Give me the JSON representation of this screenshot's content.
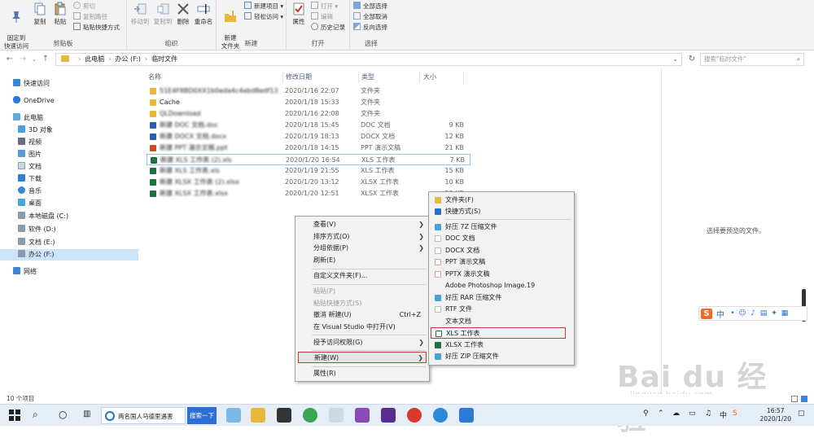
{
  "ribbon": {
    "clipboard": {
      "pin_label": "固定到\n快速访问",
      "copy_label": "复制",
      "paste_label": "粘贴",
      "cut_label": "剪切",
      "copy_path_label": "复制路径",
      "paste_shortcut_label": "粘贴快捷方式",
      "group_label": "剪贴板"
    },
    "organize": {
      "move_to_label": "移动到",
      "copy_to_label": "复制到",
      "delete_label": "删除",
      "rename_label": "重命名",
      "group_label": "组织"
    },
    "new": {
      "new_folder_label": "新建\n文件夹",
      "new_item_label": "新建项目 ▾",
      "easy_access_label": "轻松访问 ▾",
      "group_label": "新建"
    },
    "open": {
      "properties_label": "属性",
      "open_label": "打开 ▾",
      "edit_label": "编辑",
      "history_label": "历史记录",
      "group_label": "打开"
    },
    "select": {
      "select_all_label": "全部选择",
      "select_none_label": "全部取消",
      "invert_label": "反向选择",
      "group_label": "选择"
    }
  },
  "address": {
    "crumbs": [
      "此电脑",
      "办公 (F:)",
      "临时文件"
    ],
    "search_placeholder": "搜索\"临时文件\""
  },
  "nav": {
    "items": [
      {
        "label": "快速访问"
      },
      {
        "label": "OneDrive"
      },
      {
        "label": "此电脑"
      },
      {
        "label": "3D 对象"
      },
      {
        "label": "视频"
      },
      {
        "label": "图片"
      },
      {
        "label": "文档"
      },
      {
        "label": "下载"
      },
      {
        "label": "音乐"
      },
      {
        "label": "桌面"
      },
      {
        "label": "本地磁盘 (C:)"
      },
      {
        "label": "软件 (D:)"
      },
      {
        "label": "文档 (E:)"
      },
      {
        "label": "办公 (F:)"
      },
      {
        "label": "网络"
      }
    ]
  },
  "filelist": {
    "columns": {
      "name": "名称",
      "date": "修改日期",
      "type": "类型",
      "size": "大小"
    },
    "rows": [
      {
        "name": "51E4F8BD0XX1b0eda4c4ebd8edf13",
        "date": "2020/1/16 22:07",
        "type": "文件夹",
        "size": "",
        "kind": "folder"
      },
      {
        "name": "Cache",
        "date": "2020/1/18 15:33",
        "type": "文件夹",
        "size": "",
        "kind": "folder"
      },
      {
        "name": "QLDownload",
        "date": "2020/1/16 22:08",
        "type": "文件夹",
        "size": "",
        "kind": "folder"
      },
      {
        "name": "新建 DOC 文档.doc",
        "date": "2020/1/18 15:45",
        "type": "DOC 文档",
        "size": "9 KB",
        "kind": "doc"
      },
      {
        "name": "新建 DOCX 文档.docx",
        "date": "2020/1/19 18:13",
        "type": "DOCX 文档",
        "size": "12 KB",
        "kind": "doc"
      },
      {
        "name": "新建 PPT 演示文稿.ppt",
        "date": "2020/1/18 14:15",
        "type": "PPT 演示文稿",
        "size": "21 KB",
        "kind": "ppt"
      },
      {
        "name": "新建 XLS 工作表 (2).xls",
        "date": "2020/1/20 16:54",
        "type": "XLS 工作表",
        "size": "7 KB",
        "kind": "xls"
      },
      {
        "name": "新建 XLS 工作表.xls",
        "date": "2020/1/19 21:55",
        "type": "XLS 工作表",
        "size": "15 KB",
        "kind": "xls"
      },
      {
        "name": "新建 XLSX 工作表 (2).xlsx",
        "date": "2020/1/20 13:12",
        "type": "XLSX 工作表",
        "size": "10 KB",
        "kind": "xlsx"
      },
      {
        "name": "新建 XLSX 工作表.xlsx",
        "date": "2020/1/20 12:51",
        "type": "XLSX 工作表",
        "size": "10 KB",
        "kind": "xlsx"
      }
    ]
  },
  "preview": {
    "text": "选择要预览的文件。"
  },
  "context_menu": {
    "view": "查看(V)",
    "sort": "排序方式(O)",
    "group": "分组依据(P)",
    "refresh": "刷新(E)",
    "customize": "自定义文件夹(F)...",
    "paste": "粘贴(P)",
    "paste_shortcut": "粘贴快捷方式(S)",
    "undo": "撤消 新建(U)",
    "undo_shortcut": "Ctrl+Z",
    "open_vs": "在 Visual Studio 中打开(V)",
    "grant_access": "授予访问权限(G)",
    "new": "新建(W)",
    "properties": "属性(R)"
  },
  "new_submenu": {
    "items": [
      {
        "label": "文件夹(F)",
        "color": "#e8b83a"
      },
      {
        "label": "快捷方式(S)",
        "color": "#2f6fbf"
      },
      {
        "label": "好压 7Z 压缩文件",
        "color": "#4aa3d8"
      },
      {
        "label": "DOC 文档",
        "color": "#2b5fad"
      },
      {
        "label": "DOCX 文档",
        "color": "#2b5fad"
      },
      {
        "label": "PPT 演示文稿",
        "color": "#d24726"
      },
      {
        "label": "PPTX 演示文稿",
        "color": "#d24726"
      },
      {
        "label": "Adobe Photoshop Image.19",
        "color": "#ffffff"
      },
      {
        "label": "好压 RAR 压缩文件",
        "color": "#4aa3d8"
      },
      {
        "label": "RTF 文件",
        "color": "#2b5fad"
      },
      {
        "label": "文本文档",
        "color": "#ffffff"
      },
      {
        "label": "XLS 工作表",
        "color": "#1e7145"
      },
      {
        "label": "XLSX 工作表",
        "color": "#1e7145"
      },
      {
        "label": "好压 ZIP 压缩文件",
        "color": "#4aa3d8"
      }
    ]
  },
  "status": {
    "count": "10 个项目"
  },
  "taskbar": {
    "window_title": "两名国人马德里遇害",
    "search_button": "搜索一下",
    "time": "16:57",
    "date": "2020/1/20"
  },
  "ime": {
    "logo": "S",
    "mode": "中"
  },
  "watermark": {
    "main": "Bai du 经验",
    "sub": "jingyan.baidu.com"
  }
}
